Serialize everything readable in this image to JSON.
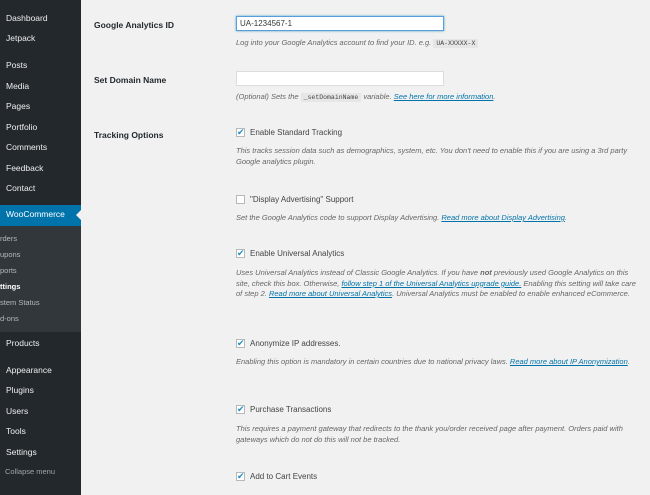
{
  "sidebar": {
    "items": [
      {
        "label": "Dashboard"
      },
      {
        "label": "Jetpack"
      },
      {
        "label": "Posts"
      },
      {
        "label": "Media"
      },
      {
        "label": "Pages"
      },
      {
        "label": "Portfolio"
      },
      {
        "label": "Comments"
      },
      {
        "label": "Feedback"
      },
      {
        "label": "Contact"
      }
    ],
    "woocommerce": "WooCommerce",
    "submenu": [
      "rders",
      "upons",
      "ports",
      "ttings",
      "stem Status",
      "d-ons"
    ],
    "items_bottom": [
      {
        "label": "Products"
      },
      {
        "label": "Appearance"
      },
      {
        "label": "Plugins"
      },
      {
        "label": "Users"
      },
      {
        "label": "Tools"
      },
      {
        "label": "Settings"
      }
    ],
    "collapse": "Collapse menu"
  },
  "settings": {
    "ga_id": {
      "label": "Google Analytics ID",
      "value": "UA-1234567-1",
      "desc_prefix": "Log into your Google Analytics account to find your ID. e.g. ",
      "desc_code": "UA-XXXXX-X"
    },
    "domain": {
      "label": "Set Domain Name",
      "value": "",
      "desc_prefix": "(Optional) Sets the ",
      "desc_code": "_setDomainName",
      "desc_middle": " variable. ",
      "desc_link": "See here for more information",
      "desc_suffix": "."
    },
    "tracking": {
      "label": "Tracking Options",
      "standard": {
        "label": "Enable Standard Tracking",
        "checked": true,
        "desc": "This tracks session data such as demographics, system, etc. You don't need to enable this if you are using a 3rd party Google analytics plugin."
      },
      "display": {
        "label": "\"Display Advertising\" Support",
        "checked": false,
        "desc_prefix": "Set the Google Analytics code to support Display Advertising. ",
        "desc_link": "Read more about Display Advertising",
        "desc_suffix": "."
      },
      "universal": {
        "label": "Enable Universal Analytics",
        "checked": true,
        "desc_1": "Uses Universal Analytics instead of Classic Google Analytics. If you have ",
        "desc_bold": "not",
        "desc_2": " previously used Google Analytics on this site, check this box. Otherwise, ",
        "desc_link1": "follow step 1 of the Universal Analytics upgrade guide.",
        "desc_3": " Enabling this setting will take care of step 2. ",
        "desc_link2": "Read more about Universal Analytics",
        "desc_4": ". Universal Analytics must be enabled to enable enhanced eCommerce."
      },
      "anonymize": {
        "label": "Anonymize IP addresses.",
        "checked": true,
        "desc_prefix": "Enabling this option is mandatory in certain countries due to national privacy laws. ",
        "desc_link": "Read more about IP Anonymization",
        "desc_suffix": "."
      },
      "purchase": {
        "label": "Purchase Transactions",
        "checked": true,
        "desc": "This requires a payment gateway that redirects to the thank you/order received page after payment. Orders paid with gateways which do not do this will not be tracked."
      },
      "cart": {
        "label": "Add to Cart Events",
        "checked": true
      }
    }
  },
  "colors": {
    "sidebar_bg": "#23282d",
    "submenu_bg": "#32373c",
    "active": "#0073aa",
    "link": "#0073aa",
    "check": "#1e8cbe"
  }
}
